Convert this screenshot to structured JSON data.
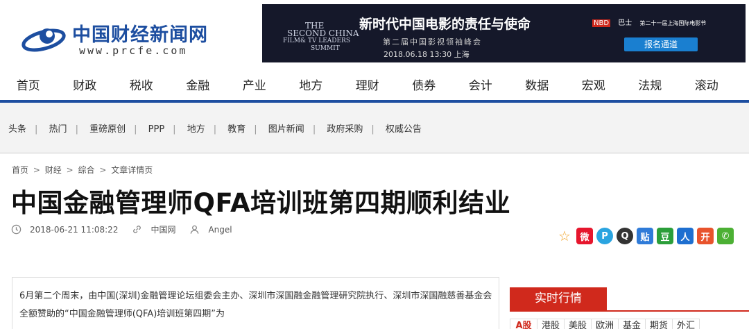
{
  "site": {
    "title": "中国财经新闻网",
    "url": "www.prcfe.com"
  },
  "banner": {
    "left_lines": [
      "THE",
      "SECOND CHINA",
      "FILM& TV LEADERS",
      "SUMMIT"
    ],
    "title": "新时代中国电影的责任与使命",
    "subtitle": "第二届中国影视领袖峰会",
    "date": "2018.06.18 13:30 上海",
    "partners": [
      "NBD",
      "巴士",
      "第二十一届上海国际电影节"
    ],
    "button": "报名通道"
  },
  "main_nav": [
    "首页",
    "财政",
    "税收",
    "金融",
    "产业",
    "地方",
    "理财",
    "债券",
    "会计",
    "数据",
    "宏观",
    "法规",
    "滚动"
  ],
  "sub_nav": [
    "头条",
    "热门",
    "重磅原创",
    "PPP",
    "地方",
    "教育",
    "图片新闻",
    "政府采购",
    "权威公告"
  ],
  "breadcrumb": [
    "首页",
    "财经",
    "综合",
    "文章详情页"
  ],
  "breadcrumb_sep": ">",
  "article": {
    "title": "中国金融管理师QFA培训班第四期顺利结业",
    "date": "2018-06-21 11:08:22",
    "source": "中国网",
    "author": "Angel",
    "lead": "6月第二个周末，由中国(深圳)金融管理论坛组委会主办、深圳市深国融金融管理研究院执行、深圳市深国融慈善基金会全额赞助的“中国金融管理师(QFA)培训班第四期”为"
  },
  "share_icons": [
    {
      "name": "favorite-icon",
      "glyph": "☆",
      "color": "#f0a020"
    },
    {
      "name": "weibo-icon",
      "glyph": "微",
      "color": "#e6162d"
    },
    {
      "name": "tencent-weibo-icon",
      "glyph": "P",
      "color": "#2aa4e0"
    },
    {
      "name": "qq-icon",
      "glyph": "Q",
      "color": "#333333"
    },
    {
      "name": "tieba-icon",
      "glyph": "贴",
      "color": "#2f7bd8"
    },
    {
      "name": "douban-icon",
      "glyph": "豆",
      "color": "#2b9e3a"
    },
    {
      "name": "renren-icon",
      "glyph": "人",
      "color": "#1e6fd0"
    },
    {
      "name": "kaixin-icon",
      "glyph": "开",
      "color": "#e8532c"
    },
    {
      "name": "wechat-icon",
      "glyph": "✆",
      "color": "#4cb034"
    }
  ],
  "sidebar": {
    "heading": "实时行情",
    "tabs": [
      "A股",
      "港股",
      "美股",
      "欧洲",
      "基金",
      "期货",
      "外汇"
    ]
  },
  "colors": {
    "brand": "#1d4ea0",
    "accent": "#d0291c"
  }
}
